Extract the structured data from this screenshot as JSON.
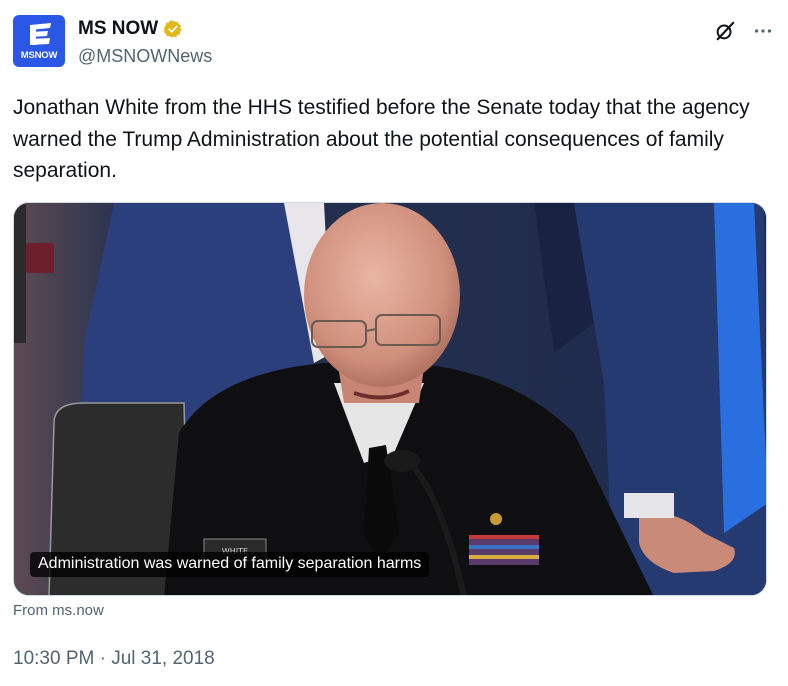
{
  "account": {
    "display_name": "MS NOW",
    "handle": "@MSNOWNews",
    "avatar_label": "MSNOW",
    "verified_icon": "gold-verified-badge-icon",
    "brand_color": "#2a57e6"
  },
  "actions": {
    "grok_icon": "grok-icon",
    "more_icon": "more-options-icon"
  },
  "tweet": {
    "text": "Jonathan White from the HHS testified before the Senate today that the agency warned the Trump Administration about the potential consequences of family separation."
  },
  "media": {
    "caption": "Administration was warned of family separation harms",
    "nameplate_text": "WHITE"
  },
  "source": "From ms.now",
  "timestamp": "10:30 PM · Jul 31, 2018"
}
